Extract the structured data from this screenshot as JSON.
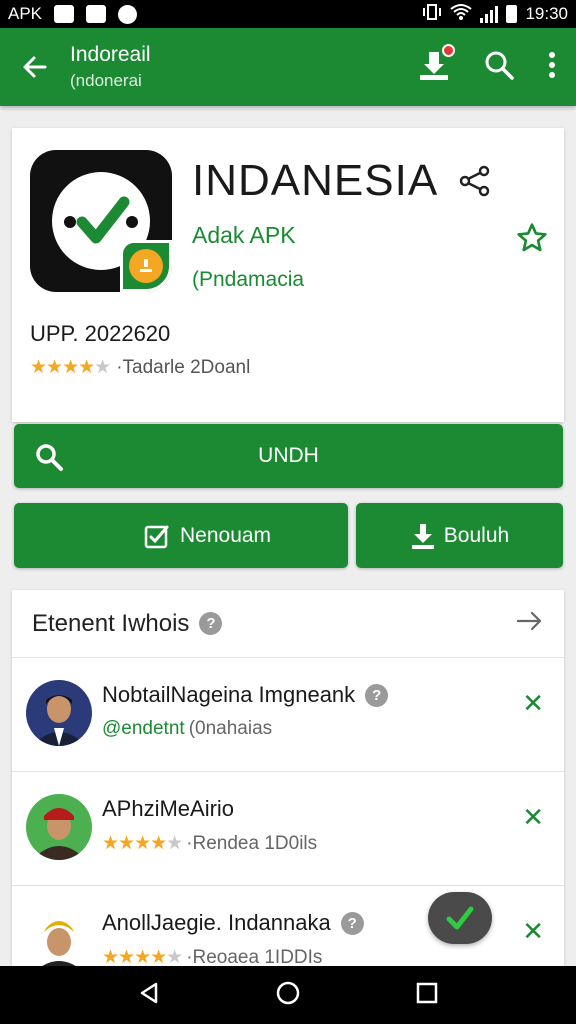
{
  "status_bar": {
    "carrier": "APK",
    "time": "19:30",
    "icons": [
      "message-icon",
      "mail-icon",
      "app-icon",
      "vibrate-icon",
      "wifi-icon",
      "signal-icon",
      "battery-icon"
    ]
  },
  "app_bar": {
    "title": "Indoreail",
    "subtitle": "(ndonerai",
    "icons": [
      "back-arrow-icon",
      "download-notification-icon",
      "search-icon",
      "more-vert-icon"
    ]
  },
  "app_info": {
    "name": "INDANESIA",
    "developer": "Adak APK",
    "subtitle": "(Pndamacia",
    "version": "UPP. 2022620",
    "rating_stars": 3.5,
    "rating_text": "·Tadarle 2Doanl"
  },
  "buttons": {
    "primary": "UNDH",
    "secondary_left": "Nenouam",
    "secondary_right": "Bouluh"
  },
  "list": {
    "title": "Etenent Iwhois",
    "help": "?",
    "items": [
      {
        "name": "NobtailNageina Imgneank",
        "handle": "@endetnt",
        "note": "(0nahaias",
        "has_help": true
      },
      {
        "name": "APhziMeAirio",
        "stars": 4,
        "note": "·Rendea 1D0ils",
        "has_help": false
      },
      {
        "name": "AnollJaegie. Indannaka",
        "stars": 4,
        "note": "·Reoaea 1IDDIs",
        "has_help": true
      }
    ]
  },
  "colors": {
    "brand_green": "#1b8a33",
    "star_yellow": "#f5a623",
    "badge_orange": "#f5a623"
  }
}
